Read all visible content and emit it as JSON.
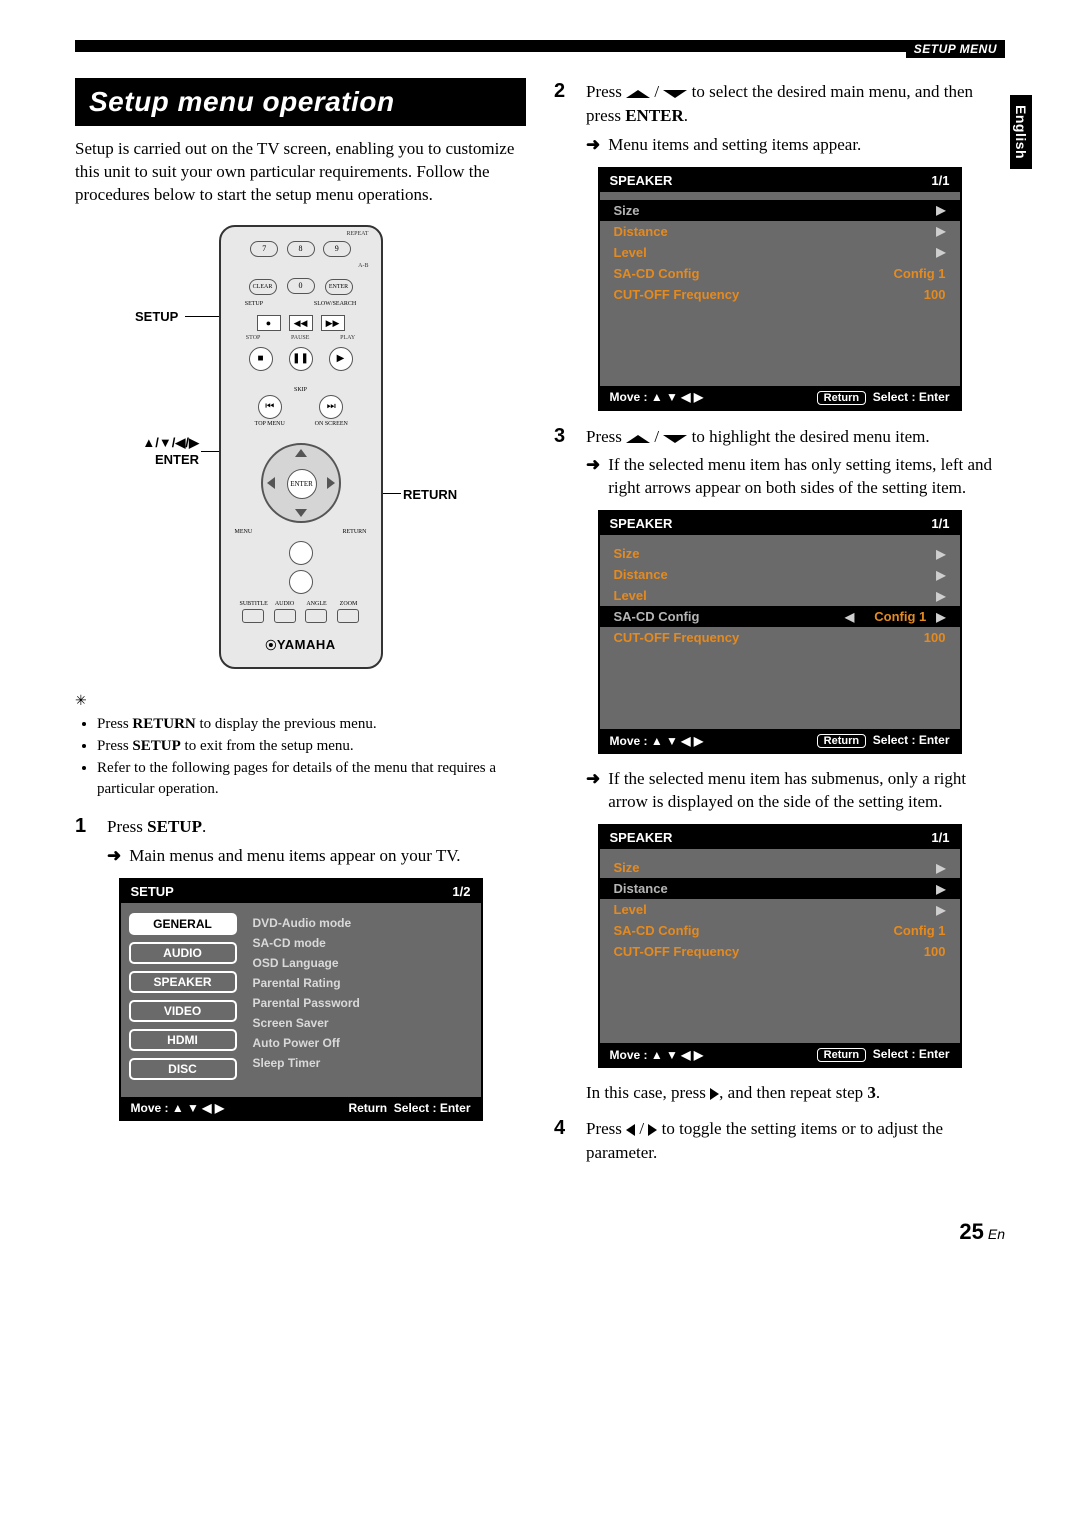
{
  "header": {
    "setup_menu": "SETUP MENU"
  },
  "side_tab": "English",
  "section_title": "Setup menu operation",
  "intro_paragraph": "Setup is carried out on the TV screen, enabling you to customize this unit to suit your own particular requirements. Follow the procedures below to start the setup menu operations.",
  "remote": {
    "callout_setup": "SETUP",
    "callout_enter": "ENTER",
    "callout_return": "RETURN",
    "callout_arrows": "▲/▼/◀/▶",
    "btn_7": "7",
    "btn_8": "8",
    "btn_9": "9",
    "btn_clear": "CLEAR",
    "btn_0": "0",
    "btn_enter_small": "ENTER",
    "lbl_repeat": "REPEAT",
    "lbl_ab": "A-B",
    "lbl_setup": "SETUP",
    "lbl_slow": "SLOW/SEARCH",
    "lbl_stop": "STOP",
    "lbl_pause": "PAUSE",
    "lbl_play": "PLAY",
    "lbl_skip": "SKIP",
    "lbl_topmenu": "TOP MENU",
    "lbl_onscreen": "ON SCREEN",
    "lbl_enter_big": "ENTER",
    "lbl_menu": "MENU",
    "lbl_return": "RETURN",
    "lbl_subtitle": "SUBTITLE",
    "lbl_audio": "AUDIO",
    "lbl_angle": "ANGLE",
    "lbl_zoom": "ZOOM",
    "brand": "YAMAHA"
  },
  "tips": {
    "t1_a": "Press ",
    "t1_b": "RETURN",
    "t1_c": " to display the previous menu.",
    "t2_a": "Press ",
    "t2_b": "SETUP",
    "t2_c": " to exit from the setup menu.",
    "t3": "Refer to the following pages for details of the menu that requires a particular operation."
  },
  "steps": {
    "s1": {
      "num": "1",
      "a": "Press ",
      "b": "SETUP",
      "c": "."
    },
    "s1_sub": "Main menus and menu items appear on your TV.",
    "s2": {
      "num": "2",
      "a": "Press ",
      "b": " / ",
      "c": " to select the desired main menu, and then press ",
      "d": "ENTER",
      "e": "."
    },
    "s2_sub": "Menu items and setting items appear.",
    "s3": {
      "num": "3",
      "a": "Press ",
      "b": " / ",
      "c": " to highlight the desired menu item."
    },
    "s3_sub1": "If the selected menu item has only setting items, left and right arrows appear on both sides of the setting item.",
    "s3_sub2": "If the selected menu item has submenus, only a right arrow is displayed on the side of the setting item.",
    "s3_after_a": "In this case, press ",
    "s3_after_b": ", and then repeat step ",
    "s3_after_c": "3",
    "s3_after_d": ".",
    "s4": {
      "num": "4",
      "a": "Press ",
      "b": " / ",
      "c": " to toggle the setting items or to adjust the parameter."
    }
  },
  "setup_osd": {
    "title": "SETUP",
    "page": "1/2",
    "tabs": [
      "GENERAL",
      "AUDIO",
      "SPEAKER",
      "VIDEO",
      "HDMI",
      "DISC"
    ],
    "items": [
      "DVD-Audio mode",
      "SA-CD mode",
      "OSD Language",
      "Parental Rating",
      "Parental Password",
      "Screen Saver",
      "Auto Power Off",
      "Sleep Timer"
    ],
    "move": "Move : ▲ ▼ ◀ ▶",
    "return": "Return",
    "select": "Select :   Enter"
  },
  "speaker_osd": {
    "title": "SPEAKER",
    "page": "1/1",
    "rows": {
      "size": "Size",
      "distance": "Distance",
      "level": "Level",
      "sacd": "SA-CD Config",
      "sacd_val": "Config 1",
      "cutoff": "CUT-OFF Frequency",
      "cutoff_val": "100"
    },
    "move": "Move : ▲ ▼ ◀ ▶",
    "return": "Return",
    "select": "Select :   Enter"
  },
  "footer": {
    "page_num": "25",
    "suffix": "En"
  }
}
